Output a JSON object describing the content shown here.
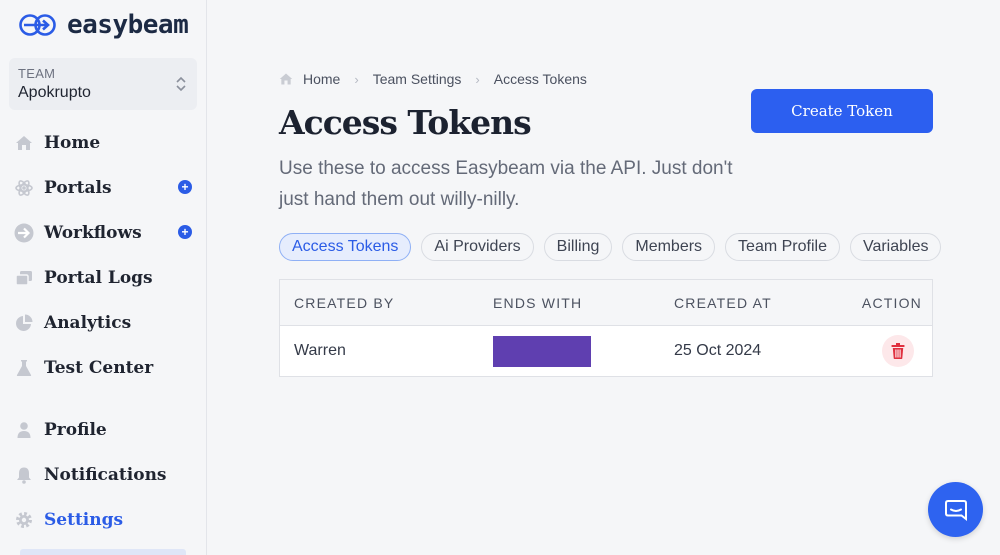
{
  "app": {
    "name": "easybeam"
  },
  "team": {
    "label": "TEAM",
    "name": "Apokrupto"
  },
  "sidebar": {
    "items": [
      {
        "label": "Home",
        "icon": "home-icon"
      },
      {
        "label": "Portals",
        "icon": "atom-icon",
        "has_add": true
      },
      {
        "label": "Workflows",
        "icon": "arrow-circle-icon",
        "has_add": true
      },
      {
        "label": "Portal Logs",
        "icon": "windows-icon"
      },
      {
        "label": "Analytics",
        "icon": "pie-chart-icon"
      },
      {
        "label": "Test Center",
        "icon": "flask-icon"
      }
    ],
    "bottom_items": [
      {
        "label": "Profile",
        "icon": "user-icon"
      },
      {
        "label": "Notifications",
        "icon": "bell-icon"
      },
      {
        "label": "Settings",
        "icon": "gear-icon",
        "active": true
      }
    ],
    "add_symbol": "+"
  },
  "breadcrumb": [
    "Home",
    "Team Settings",
    "Access Tokens"
  ],
  "breadcrumb_separator": "›",
  "page": {
    "title": "Access Tokens",
    "description": "Use these to access Easybeam via the API. Just don't just hand them out willy-nilly.",
    "create_button": "Create Token"
  },
  "tabs": [
    {
      "label": "Access Tokens",
      "active": true
    },
    {
      "label": "Ai Providers"
    },
    {
      "label": "Billing"
    },
    {
      "label": "Members"
    },
    {
      "label": "Team Profile"
    },
    {
      "label": "Variables"
    }
  ],
  "table": {
    "columns": [
      "CREATED BY",
      "ENDS WITH",
      "CREATED AT",
      "ACTION"
    ],
    "rows": [
      {
        "created_by": "Warren",
        "ends_with": "",
        "created_at": "25 Oct 2024"
      }
    ]
  },
  "colors": {
    "accent": "#2c5ff0",
    "redaction": "#5f3fb0",
    "delete": "#e0303f"
  }
}
